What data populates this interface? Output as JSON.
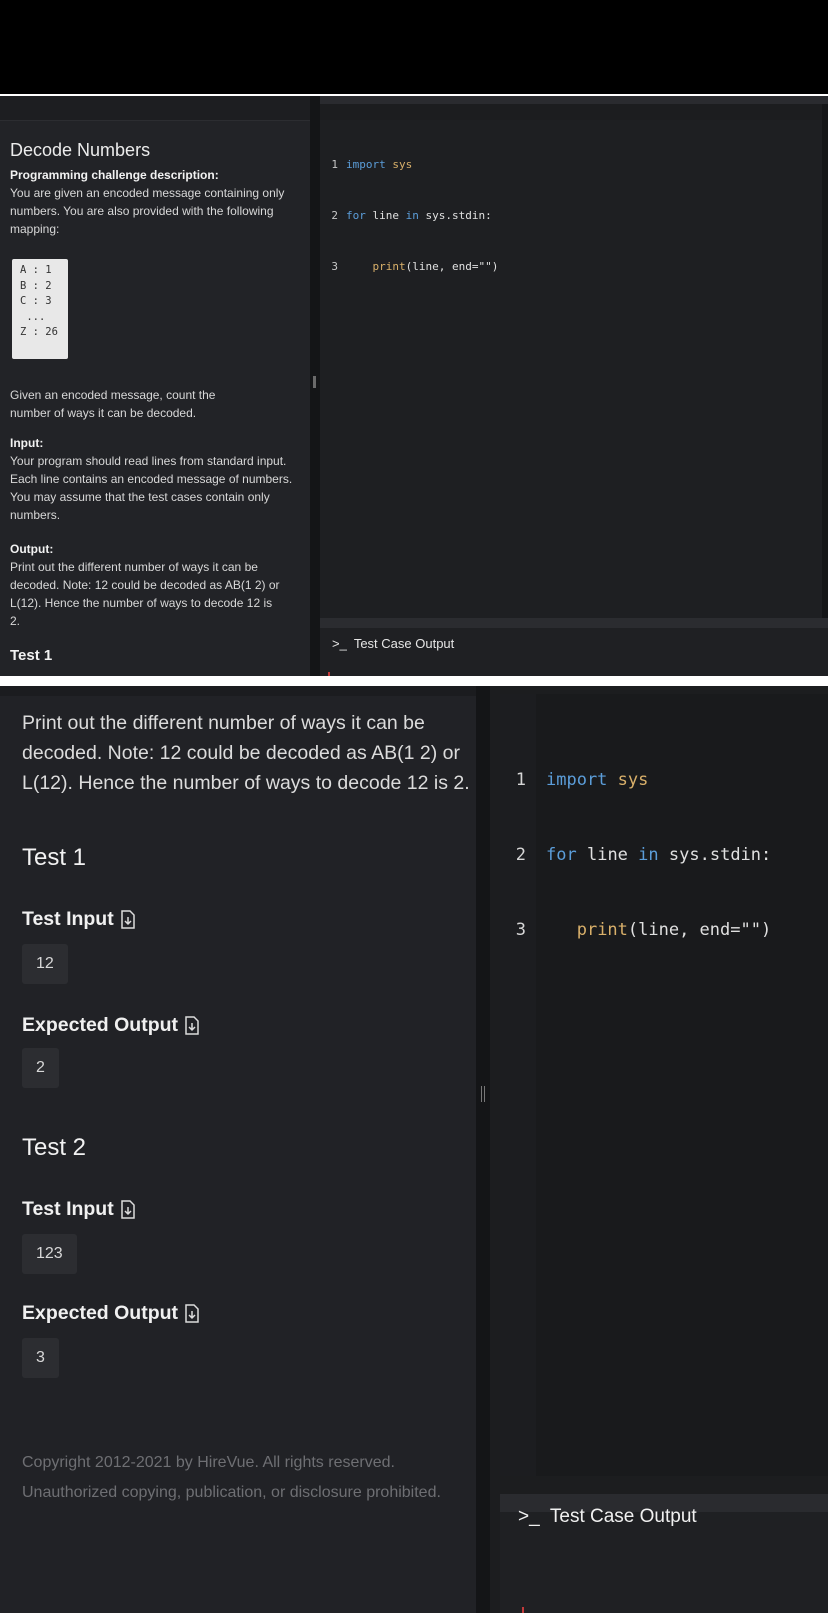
{
  "panel_small": {
    "problem_title": "Decode Numbers",
    "description_heading": "Programming challenge description:",
    "description_text": "You are given an encoded message containing only numbers. You are also provided with the following mapping:",
    "mapping": [
      "A : 1",
      "B : 2",
      "C : 3",
      " ...",
      "Z : 26"
    ],
    "task_text": "Given an encoded message, count the number of ways it can be decoded.",
    "input_heading": "Input:",
    "input_text": "Your program should read lines from standard input. Each line contains an encoded message of numbers. You may assume that the test cases contain only numbers.",
    "output_heading": "Output:",
    "output_text": "Print out the different number of ways it can be decoded. Note: 12 could be decoded as AB(1 2) or L(12). Hence the number of ways to decode 12 is 2.",
    "test_heading": "Test 1"
  },
  "panel_large": {
    "output_text": "Print out the different number of ways it can be decoded. Note: 12 could be decoded as AB(1 2) or L(12). Hence the number of ways to decode 12 is 2.",
    "tests": [
      {
        "heading": "Test 1",
        "input_label": "Test Input",
        "input_value": "12",
        "expected_label": "Expected Output",
        "expected_value": "2"
      },
      {
        "heading": "Test 2",
        "input_label": "Test Input",
        "input_value": "123",
        "expected_label": "Expected Output",
        "expected_value": "3"
      }
    ],
    "copyright": "Copyright 2012-2021 by HireVue. All rights reserved. Unauthorized copying, publication, or disclosure prohibited."
  },
  "editor": {
    "line_numbers": [
      "1",
      "2",
      "3"
    ],
    "line1": {
      "kw": "import",
      "mod": "sys"
    },
    "line2": {
      "kw1": "for",
      "id1": "line",
      "kw2": "in",
      "id2": "sys.stdin:"
    },
    "line3": {
      "fn": "print",
      "args": "(line, end=\"\")"
    }
  },
  "output_panel": {
    "prompt_icon": ">_",
    "title": "Test Case Output"
  },
  "icons": {
    "download": "download-file-icon"
  }
}
